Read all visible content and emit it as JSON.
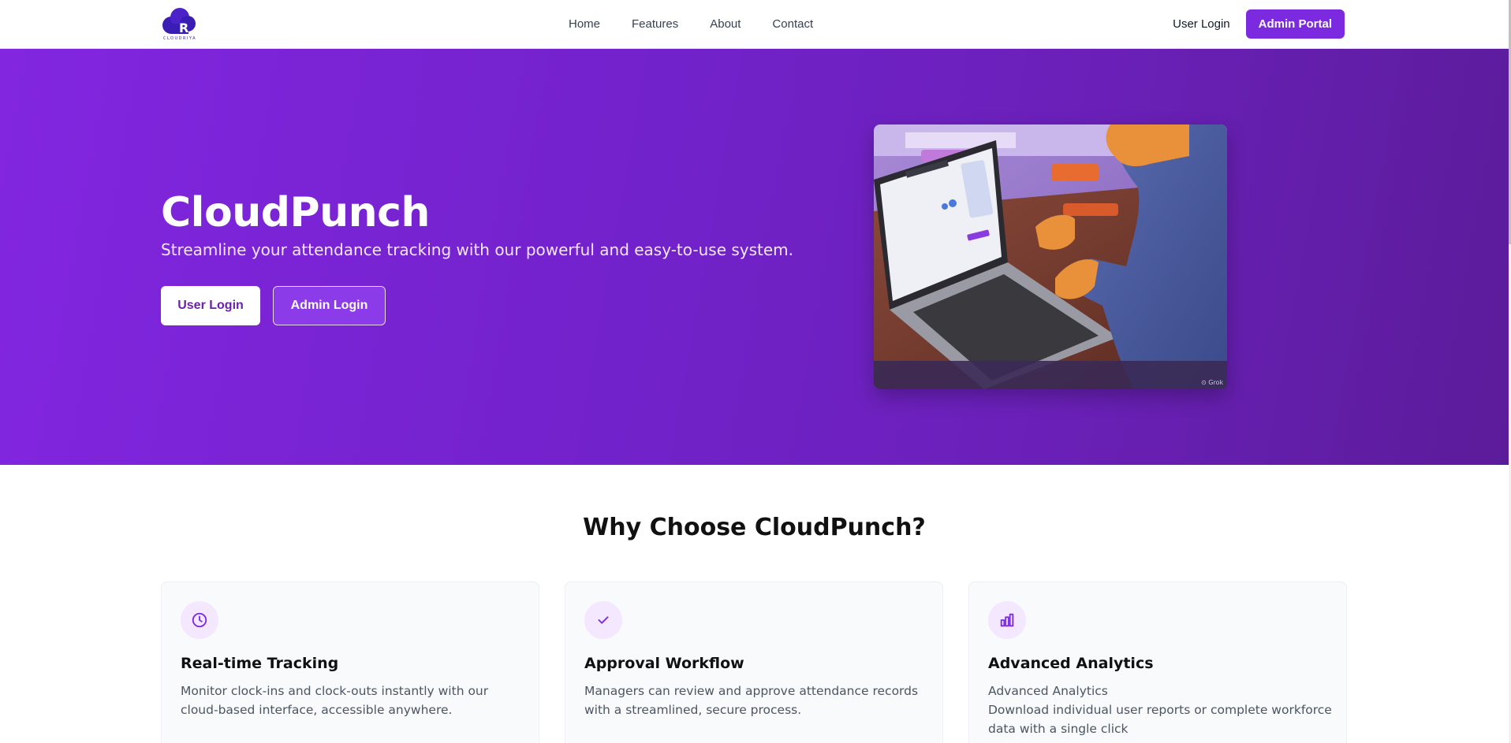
{
  "brand": {
    "logo_text": "CLOUDRIYA"
  },
  "nav": {
    "links": [
      "Home",
      "Features",
      "About",
      "Contact"
    ],
    "user_login": "User Login",
    "admin_portal": "Admin Portal"
  },
  "hero": {
    "title": "CloudPunch",
    "subtitle": "Streamline your attendance tracking with our powerful and easy-to-use system.",
    "user_login_button": "User Login",
    "admin_login_button": "Admin Login"
  },
  "features": {
    "title": "Why Choose CloudPunch?",
    "cards": [
      {
        "icon": "clock-icon",
        "title": "Real-time Tracking",
        "description": "Monitor clock-ins and clock-outs instantly with our cloud-based interface, accessible anywhere."
      },
      {
        "icon": "check-icon",
        "title": "Approval Workflow",
        "description": "Managers can review and approve attendance records with a streamlined, secure process."
      },
      {
        "icon": "bar-chart-icon",
        "title": "Advanced Analytics",
        "description_line1": "Advanced Analytics",
        "description_line2": "Download individual user reports or complete workforce data with a single click"
      }
    ]
  },
  "colors": {
    "accent": "#7c2ae0",
    "hero_start": "#8226e0",
    "hero_end": "#5b1c9a",
    "icon_bg": "#f3e8ff"
  }
}
